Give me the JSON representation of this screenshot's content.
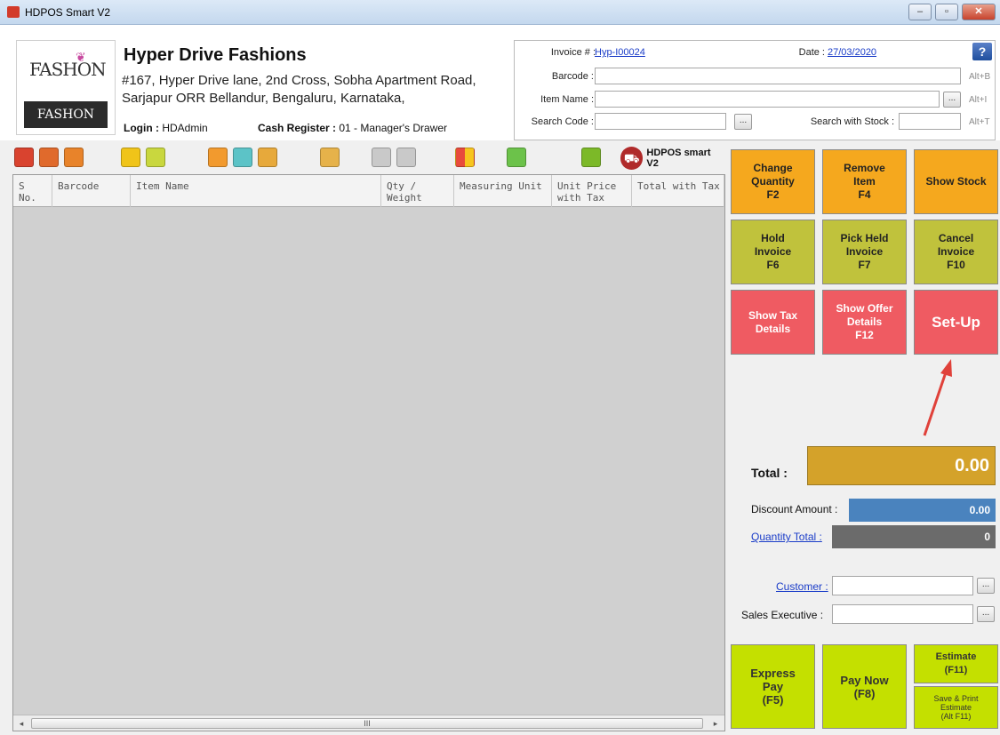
{
  "window": {
    "title": "HDPOS Smart V2",
    "controls": [
      "–",
      "▫",
      "✕"
    ]
  },
  "company": {
    "logo_top": "FASHON",
    "logo_bottom": "FASHON",
    "name": "Hyper Drive Fashions",
    "address": "#167, Hyper Drive lane, 2nd Cross, Sobha Apartment Road, Sarjapur ORR Bellandur, Bengaluru, Karnataka,",
    "login_label": "Login :",
    "login_value": "HDAdmin",
    "register_label": "Cash Register :",
    "register_value": "01 - Manager's Drawer"
  },
  "invoice": {
    "invoice_label": "Invoice # :",
    "invoice_value": "Hyp-I00024",
    "date_label": "Date :",
    "date_value": "27/03/2020",
    "barcode_label": "Barcode :",
    "barcode_hint": "Alt+B",
    "item_label": "Item Name :",
    "item_hint": "Alt+I",
    "search_label": "Search Code :",
    "stock_label": "Search with Stock :",
    "stock_hint": "Alt+T",
    "dots": "...",
    "help": "?"
  },
  "toolbar": {
    "brand": "HDPOS smart V2"
  },
  "grid": {
    "columns": [
      "S No.",
      "Barcode",
      "Item Name",
      "Qty / Weight",
      "Measuring Unit",
      "Unit Price with Tax",
      "Total with Tax"
    ],
    "scroll_mark": "III"
  },
  "function_buttons": [
    {
      "label": "Change\nQuantity\nF2"
    },
    {
      "label": "Remove\nItem\nF4"
    },
    {
      "label": "Show Stock"
    },
    {
      "label": "Hold\nInvoice\nF6"
    },
    {
      "label": "Pick Held\nInvoice\nF7"
    },
    {
      "label": "Cancel\nInvoice\nF10"
    },
    {
      "label": "Show Tax\nDetails"
    },
    {
      "label": "Show Offer\nDetails\nF12"
    },
    {
      "label": "Set-Up"
    }
  ],
  "totals": {
    "total_label": "Total :",
    "total_value": "0.00",
    "discount_label": "Discount Amount :",
    "discount_value": "0.00",
    "quantity_label": "Quantity Total :",
    "quantity_value": "0"
  },
  "customer": {
    "customer_label": "Customer :",
    "sales_label": "Sales Executive :"
  },
  "pay_buttons": {
    "express": "Express\nPay\n(F5)",
    "pay_now": "Pay Now\n(F8)",
    "estimate": "Estimate\n(F11)",
    "save_print": "Save & Print\nEstimate\n(Alt F11)"
  },
  "colors": {
    "orange": "#f5a81e",
    "olive": "#c0c23c",
    "red": "#ef5b62",
    "green": "#c4e000",
    "total_gold": "#d4a22a",
    "discount_blue": "#4a83be"
  }
}
